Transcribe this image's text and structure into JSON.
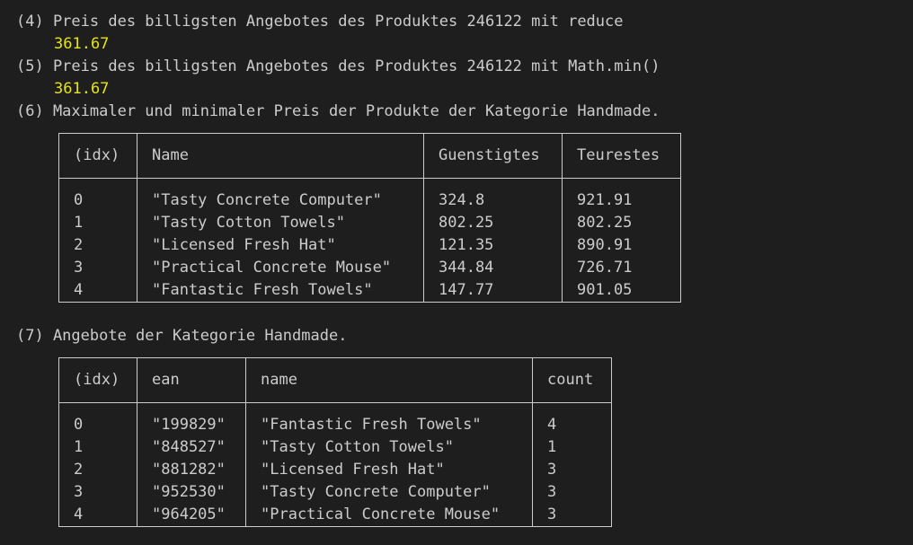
{
  "lines": {
    "l4": "(4) Preis des billigsten Angebotes des Produktes 246122 mit reduce",
    "l4_val": "361.67",
    "l5": "(5) Preis des billigsten Angebotes des Produktes 246122 mit Math.min()",
    "l5_val": "361.67",
    "l6": "(6) Maximaler und minimaler Preis der Produkte der Kategorie Handmade.",
    "l7": "(7) Angebote der Kategorie Handmade."
  },
  "table1": {
    "headers": [
      "(idx)",
      "Name",
      "Guenstigtes",
      "Teurestes"
    ],
    "rows": [
      [
        "0",
        "\"Tasty Concrete Computer\"",
        "324.8",
        "921.91"
      ],
      [
        "1",
        "\"Tasty Cotton Towels\"",
        "802.25",
        "802.25"
      ],
      [
        "2",
        "\"Licensed Fresh Hat\"",
        "121.35",
        "890.91"
      ],
      [
        "3",
        "\"Practical Concrete Mouse\"",
        "344.84",
        "726.71"
      ],
      [
        "4",
        "\"Fantastic Fresh Towels\"",
        "147.77",
        "901.05"
      ]
    ]
  },
  "table2": {
    "headers": [
      "(idx)",
      "ean",
      "name",
      "count"
    ],
    "rows": [
      [
        "0",
        "\"199829\"",
        "\"Fantastic Fresh Towels\"",
        "4"
      ],
      [
        "1",
        "\"848527\"",
        "\"Tasty Cotton Towels\"",
        "1"
      ],
      [
        "2",
        "\"881282\"",
        "\"Licensed Fresh Hat\"",
        "3"
      ],
      [
        "3",
        "\"952530\"",
        "\"Tasty Concrete Computer\"",
        "3"
      ],
      [
        "4",
        "\"964205\"",
        "\"Practical Concrete Mouse\"",
        "3"
      ]
    ]
  },
  "colors": {
    "background": "#1e1e1e",
    "text": "#cccccc",
    "number": "#e5e510",
    "string": "#23d18b"
  }
}
